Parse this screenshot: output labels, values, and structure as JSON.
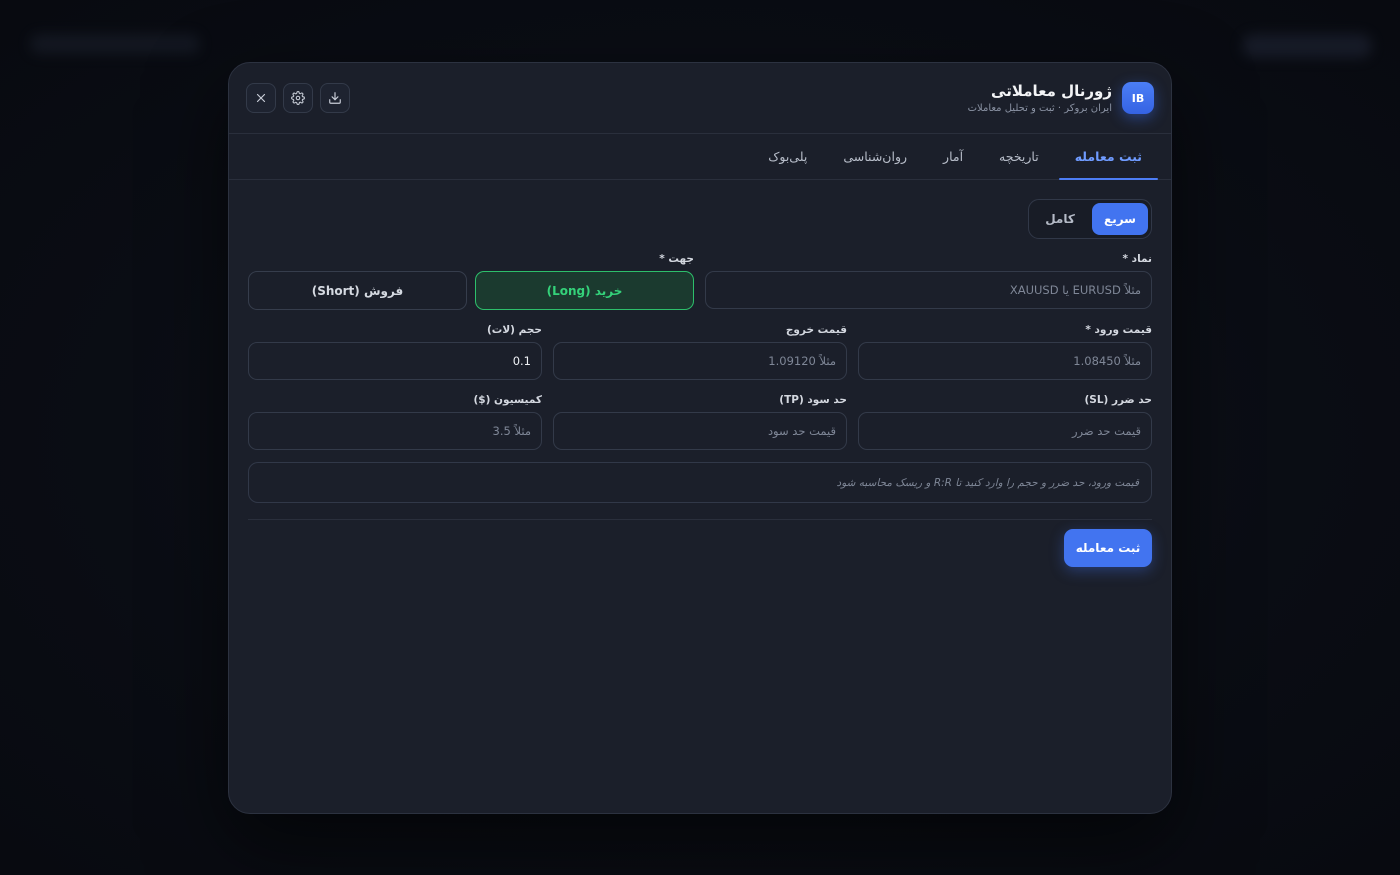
{
  "header": {
    "logo_text": "IB",
    "title": "ژورنال معاملاتی",
    "subtitle": "ایران بروکر · ثبت و تحلیل معاملات",
    "actions": [
      "download-icon",
      "gear-icon",
      "close-icon"
    ]
  },
  "tabs": [
    {
      "label": "ثبت معامله",
      "active": true
    },
    {
      "label": "تاریخچه",
      "active": false
    },
    {
      "label": "آمار",
      "active": false
    },
    {
      "label": "روان‌شناسی",
      "active": false
    },
    {
      "label": "پلی‌بوک",
      "active": false
    }
  ],
  "mode": {
    "quick": "سریع",
    "full": "کامل",
    "selected": "سریع"
  },
  "form": {
    "symbol": {
      "label": "نماد *",
      "placeholder": "مثلاً EURUSD یا XAUUSD"
    },
    "direction": {
      "label": "جهت *",
      "long": "خرید (Long)",
      "short": "فروش (Short)",
      "selected": "long"
    },
    "entry": {
      "label": "قیمت ورود *",
      "placeholder": "مثلاً 1.08450"
    },
    "exit": {
      "label": "قیمت خروج",
      "placeholder": "مثلاً 1.09120"
    },
    "volume": {
      "label": "حجم (لات)",
      "value": "0.1"
    },
    "sl": {
      "label": "حد ضرر (SL)",
      "placeholder": "قیمت حد ضرر"
    },
    "tp": {
      "label": "حد سود (TP)",
      "placeholder": "قیمت حد سود"
    },
    "commission": {
      "label": "کمیسیون ($)",
      "placeholder": "مثلاً 3.5"
    },
    "hint": "قیمت ورود، حد ضرر و حجم را وارد کنید تا R:R و ریسک محاسبه شود",
    "submit_label": "ثبت معامله"
  },
  "colors": {
    "accent": "#4274f0",
    "long_green": "#34d27a",
    "background": "#1b1f2a"
  }
}
